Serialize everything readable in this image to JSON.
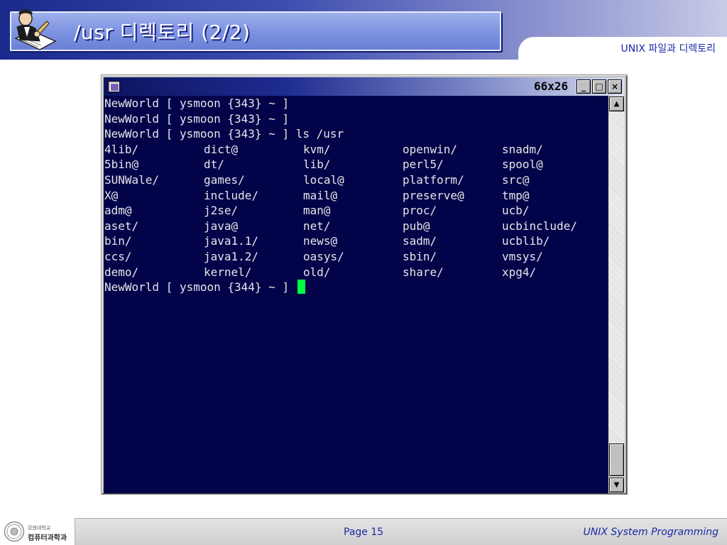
{
  "slide": {
    "title": "/usr 디렉토리 (2/2)",
    "subtitle": "UNIX 파일과 디렉토리"
  },
  "terminal": {
    "size_label": "66x26",
    "minimize_glyph": "_",
    "maximize_glyph": "□",
    "close_glyph": "×",
    "scroll_up_glyph": "▲",
    "scroll_down_glyph": "▼",
    "prompt_lines": [
      "NewWorld [ ysmoon {343} ~ ]",
      "NewWorld [ ysmoon {343} ~ ]",
      "NewWorld [ ysmoon {343} ~ ] ls /usr"
    ],
    "ls_rows": [
      [
        "4lib/",
        "dict@",
        "kvm/",
        "openwin/",
        "snadm/"
      ],
      [
        "5bin@",
        "dt/",
        "lib/",
        "perl5/",
        "spool@"
      ],
      [
        "SUNWale/",
        "games/",
        "local@",
        "platform/",
        "src@"
      ],
      [
        "X@",
        "include/",
        "mail@",
        "preserve@",
        "tmp@"
      ],
      [
        "adm@",
        "j2se/",
        "man@",
        "proc/",
        "ucb/"
      ],
      [
        "aset/",
        "java@",
        "net/",
        "pub@",
        "ucbinclude/"
      ],
      [
        "bin/",
        "java1.1/",
        "news@",
        "sadm/",
        "ucblib/"
      ],
      [
        "ccs/",
        "java1.2/",
        "oasys/",
        "sbin/",
        "vmsys/"
      ],
      [
        "demo/",
        "kernel/",
        "old/",
        "share/",
        "xpg4/"
      ]
    ],
    "final_prompt": "NewWorld [ ysmoon {344} ~ ] ",
    "colors": {
      "background": "#03034a",
      "text": "#e6e6e6",
      "cursor": "#00ff40"
    }
  },
  "footer": {
    "logo_small": "강원대학교",
    "logo_big": "컴퓨터과학과",
    "page": "Page 15",
    "course": "UNIX System Programming"
  }
}
